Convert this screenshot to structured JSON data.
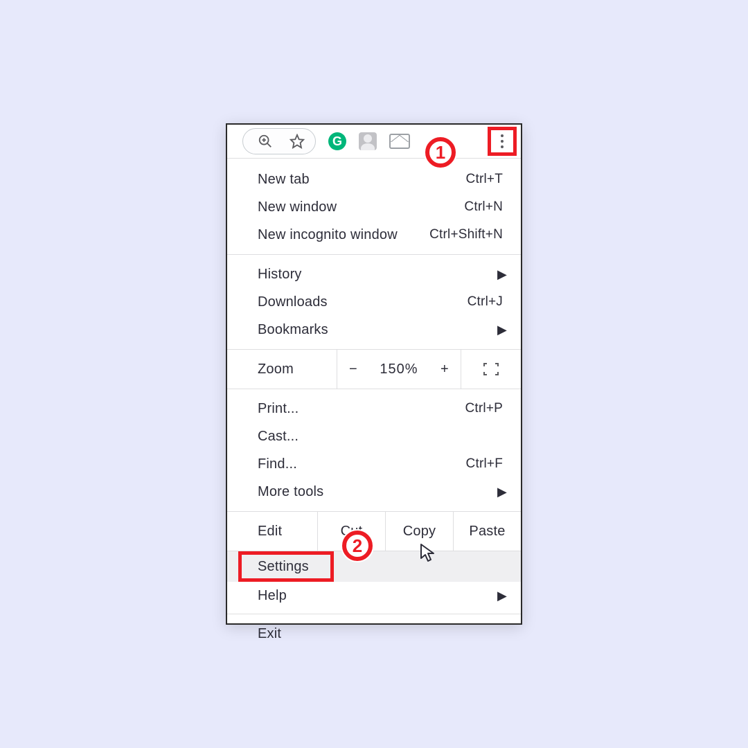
{
  "toolbar": {
    "grammarly_letter": "G"
  },
  "menu": {
    "new_tab": {
      "label": "New tab",
      "shortcut": "Ctrl+T"
    },
    "new_window": {
      "label": "New window",
      "shortcut": "Ctrl+N"
    },
    "new_incognito": {
      "label": "New incognito window",
      "shortcut": "Ctrl+Shift+N"
    },
    "history": {
      "label": "History"
    },
    "downloads": {
      "label": "Downloads",
      "shortcut": "Ctrl+J"
    },
    "bookmarks": {
      "label": "Bookmarks"
    },
    "zoom": {
      "label": "Zoom",
      "minus": "−",
      "value": "150%",
      "plus": "+"
    },
    "print": {
      "label": "Print...",
      "shortcut": "Ctrl+P"
    },
    "cast": {
      "label": "Cast..."
    },
    "find": {
      "label": "Find...",
      "shortcut": "Ctrl+F"
    },
    "more_tools": {
      "label": "More tools"
    },
    "edit": {
      "label": "Edit",
      "cut": "Cut",
      "copy": "Copy",
      "paste": "Paste"
    },
    "settings": {
      "label": "Settings"
    },
    "help": {
      "label": "Help"
    },
    "exit": {
      "label": "Exit"
    }
  },
  "annotations": {
    "step1": "1",
    "step2": "2"
  }
}
